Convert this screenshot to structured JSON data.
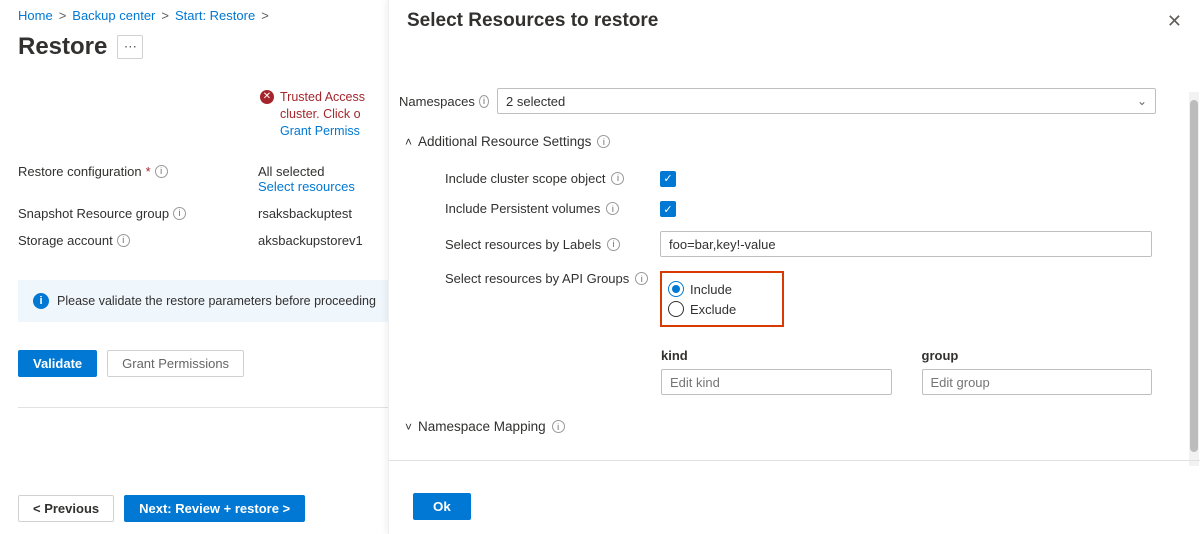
{
  "breadcrumb": {
    "items": [
      "Home",
      "Backup center",
      "Start: Restore"
    ],
    "sep": ">"
  },
  "page": {
    "title": "Restore",
    "more": "⋯"
  },
  "error": {
    "line1": "Trusted Access",
    "line2": "cluster. Click o",
    "link": "Grant Permiss"
  },
  "form": {
    "restore_config_label": "Restore configuration",
    "restore_config_value": "All selected",
    "restore_config_link": "Select resources",
    "snapshot_rg_label": "Snapshot Resource group",
    "snapshot_rg_value": "rsaksbackuptest",
    "storage_label": "Storage account",
    "storage_value": "aksbackupstorev1"
  },
  "info_bar": "Please validate the restore parameters before proceeding",
  "buttons": {
    "validate": "Validate",
    "grant": "Grant Permissions",
    "previous": "< Previous",
    "next": "Next: Review + restore >"
  },
  "blade": {
    "title": "Select Resources to restore",
    "namespaces_label": "Namespaces",
    "namespaces_selected": "2 selected",
    "section_add": "Additional Resource Settings",
    "include_cluster_scope": "Include cluster scope object",
    "include_pv": "Include Persistent volumes",
    "select_by_labels": "Select resources by Labels",
    "labels_value": "foo=bar,key!-value",
    "select_by_api": "Select resources by API Groups",
    "include": "Include",
    "exclude": "Exclude",
    "kind_label": "kind",
    "group_label": "group",
    "kind_placeholder": "Edit kind",
    "group_placeholder": "Edit group",
    "ns_mapping": "Namespace Mapping",
    "ok": "Ok"
  }
}
